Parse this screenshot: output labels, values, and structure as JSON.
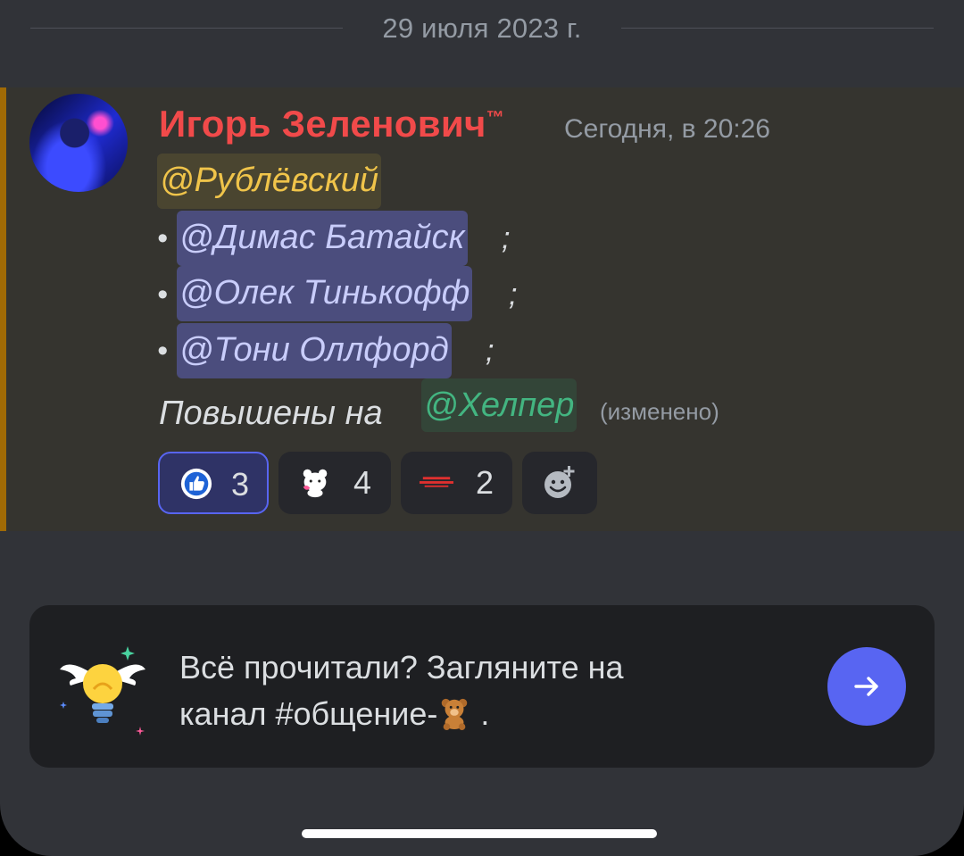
{
  "date_divider": "29 июля 2023 г.",
  "message": {
    "author": "Игорь Зеленович",
    "author_suffix": "™",
    "timestamp": "Сегодня, в 20:26",
    "role_mention": "@Рублёвский",
    "list": [
      {
        "bullet": "•",
        "mention": "@Димас Батайск",
        "tail": ";"
      },
      {
        "bullet": "•",
        "mention": "@Олек Тинькофф",
        "tail": ";"
      },
      {
        "bullet": "•",
        "mention": "@Тони Оллфорд",
        "tail": ";"
      }
    ],
    "promoted_prefix": "Повышены на",
    "promoted_role": "@Хелпер",
    "edited": "(изменено)",
    "reactions": [
      {
        "emoji": "thumbs-up-badge",
        "count": "3",
        "active": true
      },
      {
        "emoji": "bear-sticker",
        "count": "4",
        "active": false
      },
      {
        "emoji": "custom-logo",
        "count": "2",
        "active": false
      },
      {
        "emoji": "add-reaction",
        "count": "",
        "active": false
      }
    ],
    "accent_color": "#a06a05",
    "author_color": "#f14a4a"
  },
  "prompt_card": {
    "line1": "Всё прочитали? Загляните на",
    "line2_prefix": "канал #общение-",
    "line2_suffix": ".",
    "button": "arrow-right-icon"
  },
  "colors": {
    "background": "#313338",
    "brand": "#5865f2",
    "card": "#1e1f22"
  }
}
